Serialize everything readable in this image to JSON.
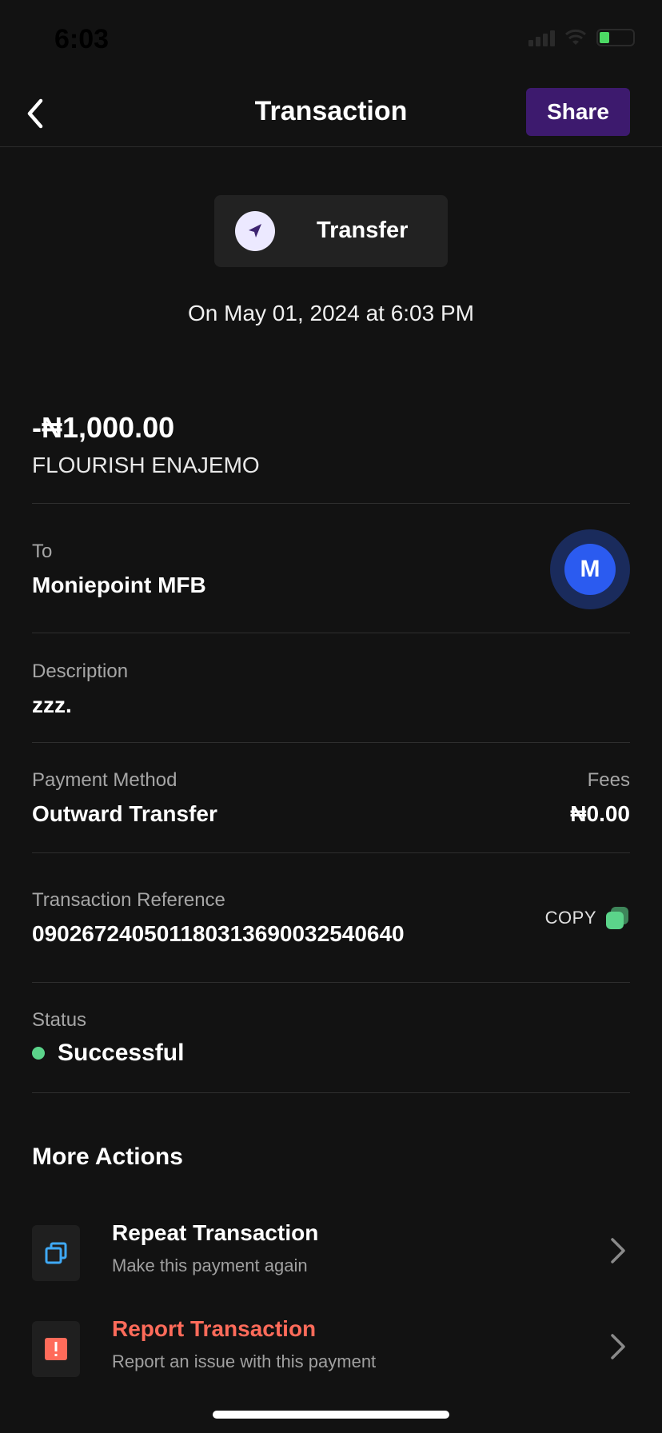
{
  "status_bar": {
    "time": "6:03"
  },
  "header": {
    "title": "Transaction",
    "share_label": "Share"
  },
  "transaction": {
    "type": "Transfer",
    "date": "On May 01, 2024 at 6:03 PM",
    "amount": "-₦1,000.00",
    "beneficiary": "FLOURISH ENAJEMO"
  },
  "details": {
    "to_label": "To",
    "to_value": "Moniepoint MFB",
    "bank_initial": "M",
    "description_label": "Description",
    "description_value": "zzz.",
    "payment_method_label": "Payment Method",
    "payment_method_value": "Outward Transfer",
    "fees_label": "Fees",
    "fees_value": "₦0.00",
    "reference_label": "Transaction Reference",
    "reference_value": "090267240501180313690032540640",
    "copy_label": "COPY",
    "status_label": "Status",
    "status_value": "Successful"
  },
  "more_actions": {
    "title": "More Actions",
    "items": [
      {
        "title": "Repeat Transaction",
        "subtitle": "Make this payment again"
      },
      {
        "title": "Report Transaction",
        "subtitle": "Report an issue with this payment"
      }
    ]
  },
  "colors": {
    "background": "#121212",
    "share_button": "#3d1a6e",
    "success": "#5bd48a",
    "danger": "#ff6b5a",
    "bank_avatar": "#2b5bf0"
  },
  "icons": {
    "back": "chevron-left-icon",
    "transfer": "send-arrow-icon",
    "copy": "copy-icon",
    "repeat": "repeat-icon",
    "report": "alert-icon",
    "chevron": "chevron-right-icon"
  }
}
